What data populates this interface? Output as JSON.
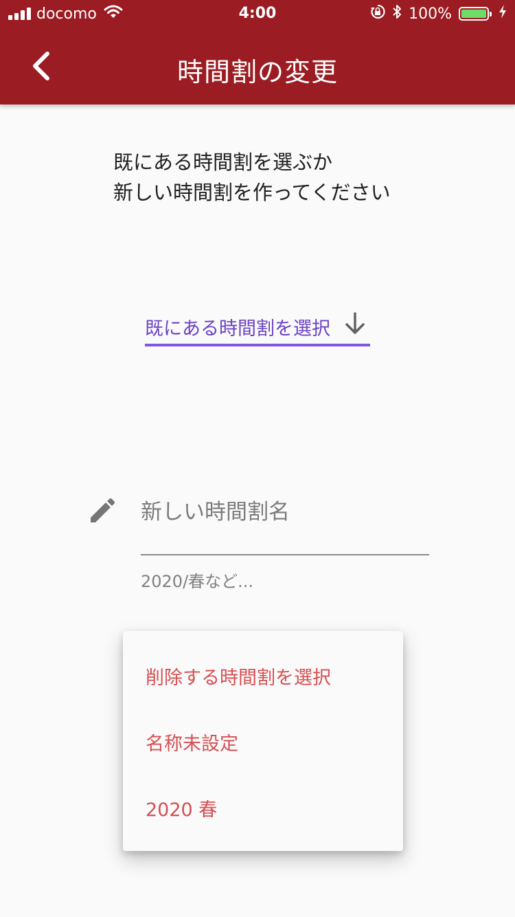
{
  "status_bar": {
    "carrier": "docomo",
    "time": "4:00",
    "battery": "100%",
    "icons": [
      "signal-icon",
      "wifi-icon",
      "rotation-lock-icon",
      "bluetooth-icon",
      "battery-icon",
      "charging-icon"
    ]
  },
  "app_bar": {
    "title": "時間割の変更",
    "back_icon": "chevron-left-icon",
    "background": "#9b1c22"
  },
  "main": {
    "instruction_line1": "既にある時間割を選ぶか",
    "instruction_line2": "新しい時間割を作ってください",
    "dropdown": {
      "label": "既にある時間割を選択",
      "icon": "arrow-down-icon",
      "accent": "#7e57e0"
    },
    "new_timetable": {
      "icon": "pencil-icon",
      "placeholder": "新しい時間割名",
      "helper": "2020/春など..."
    }
  },
  "popup_menu": {
    "items": [
      {
        "label": "削除する時間割を選択"
      },
      {
        "label": "名称未設定"
      },
      {
        "label": "2020 春"
      }
    ],
    "text_color": "#d64f52"
  }
}
